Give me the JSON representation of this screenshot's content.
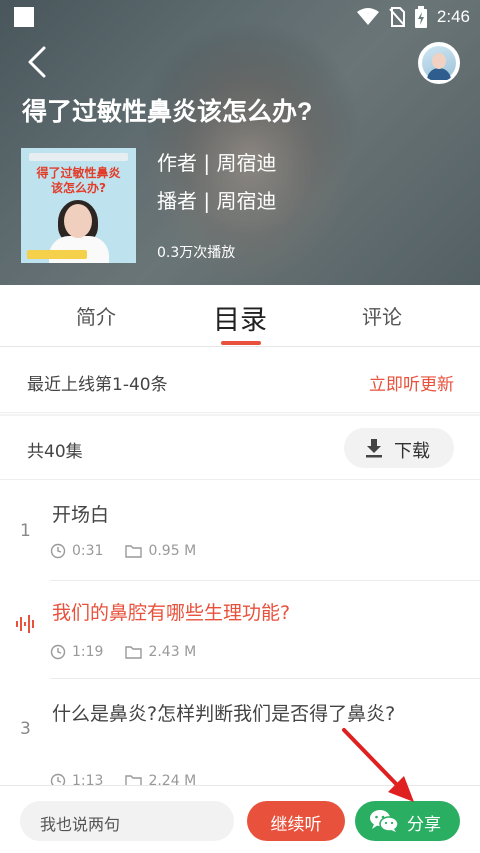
{
  "status_bar": {
    "time": "2:46"
  },
  "header": {
    "title": "得了过敏性鼻炎该怎么办?",
    "cover_text_line1": "得了过敏性鼻炎",
    "cover_text_line2": "该怎么办?",
    "author": "作者 | 周宿迪",
    "narrator": "播者 | 周宿迪",
    "plays": "0.3万次播放"
  },
  "tabs": [
    {
      "label": "简介"
    },
    {
      "label": "目录"
    },
    {
      "label": "评论"
    }
  ],
  "active_tab": "目录",
  "update_row": {
    "label": "最近上线第1-40条",
    "action": "立即听更新"
  },
  "count_row": {
    "label": "共40集",
    "download": "下载"
  },
  "episodes": [
    {
      "index": "1",
      "title": "开场白",
      "duration": "0:31",
      "size": "0.95 M",
      "playing": false
    },
    {
      "index": "",
      "title": "我们的鼻腔有哪些生理功能?",
      "duration": "1:19",
      "size": "2.43 M",
      "playing": true
    },
    {
      "index": "3",
      "title": "什么是鼻炎?怎样判断我们是否得了鼻炎?",
      "duration": "1:13",
      "size": "2.24 M",
      "playing": false
    }
  ],
  "bottom_bar": {
    "comment_placeholder": "我也说两句",
    "continue": "继续听",
    "share": "分享"
  },
  "colors": {
    "accent": "#e8523c",
    "share_green": "#2aae62"
  }
}
